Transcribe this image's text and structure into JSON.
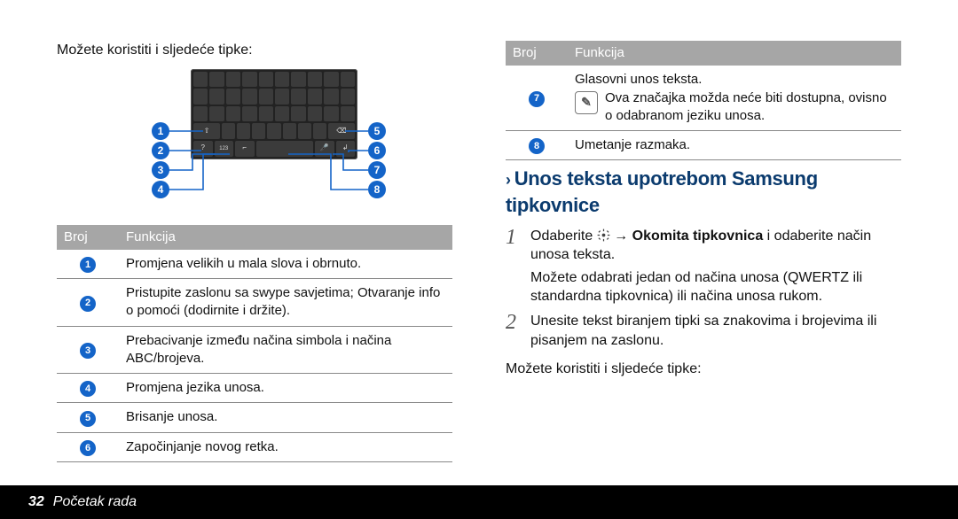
{
  "left": {
    "intro": "Možete koristiti i sljedeće tipke:",
    "table_header": {
      "num": "Broj",
      "func": "Funkcija"
    },
    "rows": [
      {
        "n": "1",
        "desc": "Promjena velikih u mala slova i obrnuto."
      },
      {
        "n": "2",
        "desc": "Pristupite zaslonu sa swype savjetima; Otvaranje info o pomoći (dodirnite i držite)."
      },
      {
        "n": "3",
        "desc": "Prebacivanje između načina simbola i načina ABC/brojeva."
      },
      {
        "n": "4",
        "desc": "Promjena jezika unosa."
      },
      {
        "n": "5",
        "desc": "Brisanje unosa."
      },
      {
        "n": "6",
        "desc": "Započinjanje novog retka."
      }
    ]
  },
  "right": {
    "table_header": {
      "num": "Broj",
      "func": "Funkcija"
    },
    "rows": [
      {
        "n": "7",
        "desc_main": "Glasovni unos teksta.",
        "desc_note": "Ova značajka možda neće biti dostupna, ovisno o odabranom jeziku unosa."
      },
      {
        "n": "8",
        "desc": "Umetanje razmaka."
      }
    ],
    "heading": "Unos teksta upotrebom Samsung tipkovnice",
    "step1_pre": "Odaberite ",
    "step1_mid": " → ",
    "step1_bold": "Okomita tipkovnica",
    "step1_post": " i odaberite način unosa teksta.",
    "step1_para2": "Možete odabrati jedan od načina unosa (QWERTZ ili standardna tipkovnica) ili načina unosa rukom.",
    "step2": "Unesite tekst biranjem tipki sa znakovima i brojevima ili pisanjem na zaslonu.",
    "outro": "Možete koristiti i sljedeće tipke:"
  },
  "footer": {
    "page": "32",
    "text": "Početak rada"
  }
}
